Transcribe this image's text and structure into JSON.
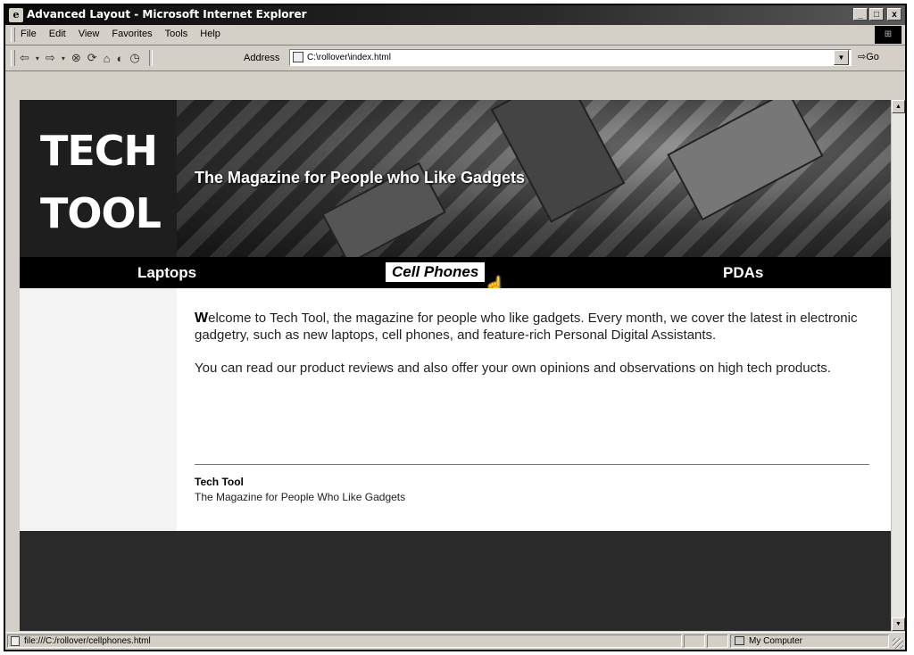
{
  "window": {
    "title": "Advanced Layout - Microsoft Internet Explorer",
    "buttons": [
      "_",
      "□",
      "x"
    ]
  },
  "menubar": {
    "items": [
      "File",
      "Edit",
      "View",
      "Favorites",
      "Tools",
      "Help"
    ]
  },
  "toolbar": {
    "back_label": "⇦",
    "forward_label": "⇨",
    "stop_icon": "stop-icon",
    "refresh_icon": "refresh-icon",
    "home_icon": "home-icon",
    "search_icon": "search-icon",
    "address_label": "Address",
    "address_value": "C:\\rollover\\index.html",
    "go_label": "Go"
  },
  "page": {
    "logo_line1": "TECH",
    "logo_line2": "TOOL",
    "tagline": "The Magazine for People who Like Gadgets",
    "nav": [
      {
        "label": "Laptops",
        "active": false
      },
      {
        "label": "Cell Phones",
        "active": true
      },
      {
        "label": "PDAs",
        "active": false
      }
    ],
    "intro_dropcap": "W",
    "intro_rest": "elcome to Tech Tool, the magazine for people who like gadgets. Every month, we cover the latest in electronic gadgetry, such as new laptops, cell phones, and feature-rich Personal Digital Assistants.",
    "paragraph2": "You can read our product reviews and also offer your own opinions and observations on high tech products.",
    "footer_title": "Tech Tool",
    "footer_subtitle": "The Magazine for People Who Like Gadgets"
  },
  "statusbar": {
    "url": "file:///C:/rollover/cellphones.html",
    "zone": "My Computer"
  }
}
